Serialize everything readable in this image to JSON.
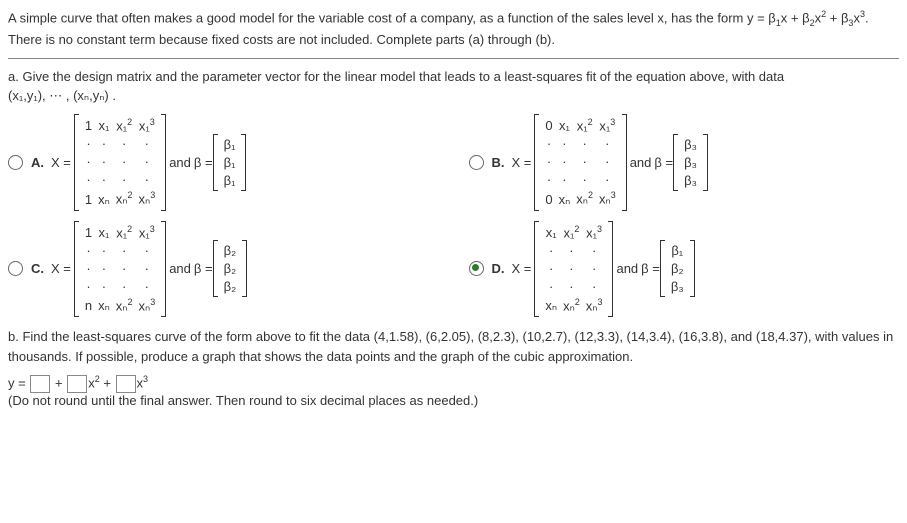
{
  "intro": {
    "line1_a": "A simple curve that often makes a good model for the variable cost of a company, as a function of the sales level x, has the form y = β",
    "line1_b": "x + β",
    "line1_c": "x",
    "line1_d": " + β",
    "line1_e": "x",
    "line1_f": ".",
    "line2": "There is no constant term because fixed costs are not included. Complete parts (a) through (b)."
  },
  "partA": {
    "prompt": "a. Give the design matrix and the parameter vector for the linear model that leads to a least-squares fit of the equation above, with data",
    "data_tuple": "(x₁,y₁), ⋯ , (xₙ,yₙ) ."
  },
  "options": {
    "A": {
      "label": "A.",
      "Xeq": "X =",
      "and": " and ",
      "beq": "β =",
      "b1": "β₁",
      "b2": "β₁",
      "b3": "β₁",
      "r1c1": "1",
      "r1c2": "x₁",
      "r1c3": "x₁",
      "r1c4": "x₁",
      "r3c1": "1",
      "r3c2": "xₙ",
      "r3c3": "xₙ",
      "r3c4": "xₙ"
    },
    "B": {
      "label": "B.",
      "Xeq": "X =",
      "and": " and ",
      "beq": "β =",
      "b1": "β₃",
      "b2": "β₃",
      "b3": "β₃",
      "r1c1": "0",
      "r1c2": "x₁",
      "r1c3": "x₁",
      "r1c4": "x₁",
      "r3c1": "0",
      "r3c2": "xₙ",
      "r3c3": "xₙ",
      "r3c4": "xₙ"
    },
    "C": {
      "label": "C.",
      "Xeq": "X =",
      "and": " and ",
      "beq": "β =",
      "b1": "β₂",
      "b2": "β₂",
      "b3": "β₂",
      "r1c1": "1",
      "r1c2": "x₁",
      "r1c3": "x₁",
      "r1c4": "x₁",
      "r3c1": "n",
      "r3c2": "xₙ",
      "r3c3": "xₙ",
      "r3c4": "xₙ"
    },
    "D": {
      "label": "D.",
      "Xeq": "X =",
      "and": " and ",
      "beq": "β =",
      "b1": "β₁",
      "b2": "β₂",
      "b3": "β₃",
      "r1c1": "x₁",
      "r1c2": "x₁",
      "r1c3": "x₁",
      "r3c1": "xₙ",
      "r3c2": "xₙ",
      "r3c3": "xₙ"
    }
  },
  "sup2": "2",
  "sup3": "3",
  "sub1": "1",
  "subn": "n",
  "partB": {
    "prompt": "b. Find the least-squares curve of the form above to fit the data (4,1.58), (6,2.05), (8,2.3), (10,2.7), (12,3.3), (14,3.4), (16,3.8), and (18,4.37), with values in thousands. If possible, produce a graph that shows the data points and the graph of the cubic approximation.",
    "eq_y": "y =",
    "eq_plus": "+",
    "eq_x": "x",
    "eq_x2": "x",
    "eq_x3": "x",
    "note": "(Do not round until the final answer. Then round to six decimal places as needed.)"
  }
}
